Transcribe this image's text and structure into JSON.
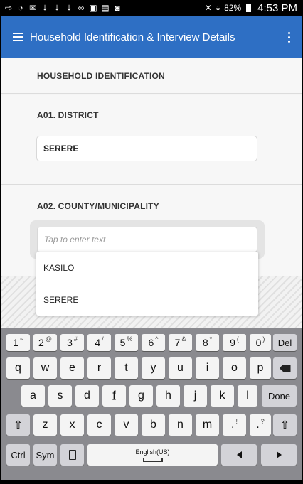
{
  "status": {
    "icons_left": [
      "cast-icon",
      "wifi-signal-icon",
      "mail-icon",
      "download-icon",
      "download-icon",
      "download-icon",
      "voicemail-icon",
      "image-icon",
      "shopping-icon",
      "camera-icon"
    ],
    "battery": "82%",
    "time": "4:53 PM"
  },
  "appbar": {
    "title": "Household Identification & Interview Details"
  },
  "form": {
    "section_title": "HOUSEHOLD IDENTIFICATION",
    "q1": {
      "label": "A01. DISTRICT",
      "value": "SERERE"
    },
    "q2": {
      "label": "A02. COUNTY/MUNICIPALITY",
      "placeholder": "Tap to enter text"
    },
    "suggestions": [
      "KASILO",
      "SERERE"
    ]
  },
  "keyboard": {
    "row1": [
      {
        "k": "1",
        "s": "~"
      },
      {
        "k": "2",
        "s": "@"
      },
      {
        "k": "3",
        "s": "#"
      },
      {
        "k": "4",
        "s": "/"
      },
      {
        "k": "5",
        "s": "%"
      },
      {
        "k": "6",
        "s": "^"
      },
      {
        "k": "7",
        "s": "&"
      },
      {
        "k": "8",
        "s": "*"
      },
      {
        "k": "9",
        "s": "("
      },
      {
        "k": "0",
        "s": ")"
      }
    ],
    "del": "Del",
    "row2": [
      "q",
      "w",
      "e",
      "r",
      "t",
      "y",
      "u",
      "i",
      "o",
      "p"
    ],
    "row3": [
      "a",
      "s",
      "d",
      "f",
      "g",
      "h",
      "j",
      "k",
      "l"
    ],
    "done": "Done",
    "row4": [
      "z",
      "x",
      "c",
      "v",
      "b",
      "n",
      "m"
    ],
    "comma": {
      "k": ",",
      "s": "!"
    },
    "period": {
      "k": ".",
      "s": "?"
    },
    "ctrl": "Ctrl",
    "sym": "Sym",
    "space": "English(US)"
  }
}
